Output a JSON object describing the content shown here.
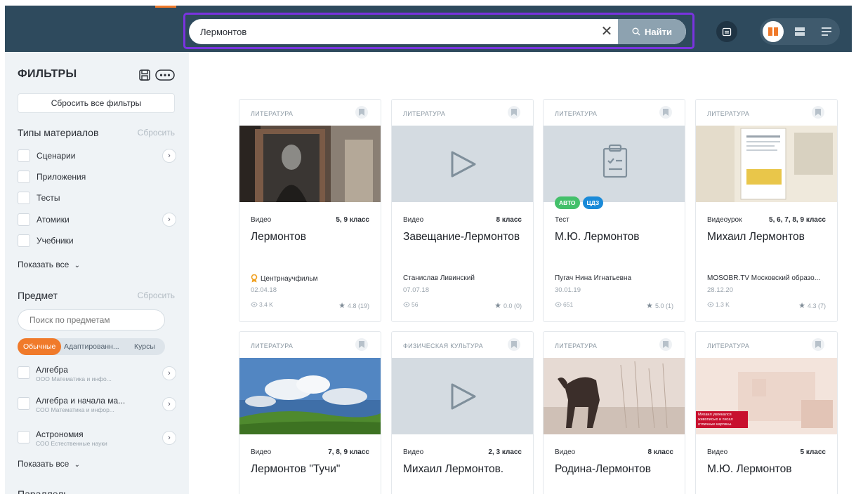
{
  "header": {
    "search_value": "Лермонтов",
    "search_button": "Найти"
  },
  "sidebar": {
    "title": "ФИЛЬТРЫ",
    "reset_all": "Сбросить все фильтры",
    "types": {
      "title": "Типы материалов",
      "reset": "Сбросить",
      "items": [
        {
          "label": "Сценарии"
        },
        {
          "label": "Приложения"
        },
        {
          "label": "Тесты"
        },
        {
          "label": "Атомики"
        },
        {
          "label": "Учебники"
        }
      ],
      "show_all": "Показать все"
    },
    "subjects": {
      "title": "Предмет",
      "reset": "Сбросить",
      "search_placeholder": "Поиск по предметам",
      "tabs": [
        "Обычные",
        "Адаптированн...",
        "Курсы"
      ],
      "items": [
        {
          "name": "Алгебра",
          "sub": "ООО Математика и инфо..."
        },
        {
          "name": "Алгебра и начала ма...",
          "sub": "СОО Математика и инфор..."
        },
        {
          "name": "Астрономия",
          "sub": "СОО Естественные науки"
        }
      ],
      "show_all": "Показать все",
      "next_title": "Параллель"
    }
  },
  "cards": [
    {
      "subject": "ЛИТЕРАТУРА",
      "type": "Видео",
      "grade": "5, 9 класс",
      "title": "Лермонтов",
      "author": "Центрнаучфильм",
      "date": "02.04.18",
      "views": "3.4 K",
      "rating": "4.8 (19)"
    },
    {
      "subject": "ЛИТЕРАТУРА",
      "type": "Видео",
      "grade": "8 класс",
      "title": "Завещание-Лермонтов",
      "author": "Станислав Ливинский",
      "date": "07.07.18",
      "views": "56",
      "rating": "0.0 (0)"
    },
    {
      "subject": "ЛИТЕРАТУРА",
      "type": "Тест",
      "grade": "",
      "title": "М.Ю. Лермонтов",
      "author": "Пугач Нина Игнатьевна",
      "date": "30.01.19",
      "views": "651",
      "rating": "5.0 (1)",
      "badges": [
        "АВТО",
        "ЦДЗ"
      ]
    },
    {
      "subject": "ЛИТЕРАТУРА",
      "type": "Видеоурок",
      "grade": "5, 6, 7, 8, 9 класс",
      "title": "Михаил Лермонтов",
      "author": "MOSOBR.TV Московский образо...",
      "date": "28.12.20",
      "views": "1.3 K",
      "rating": "4.3 (7)"
    },
    {
      "subject": "ЛИТЕРАТУРА",
      "type": "Видео",
      "grade": "7, 8, 9 класс",
      "title": "Лермонтов \"Тучи\""
    },
    {
      "subject": "ФИЗИЧЕСКАЯ КУЛЬТУРА",
      "type": "Видео",
      "grade": "2, 3 класс",
      "title": "Михаил Лермонтов."
    },
    {
      "subject": "ЛИТЕРАТУРА",
      "type": "Видео",
      "grade": "8 класс",
      "title": "Родина-Лермонтов"
    },
    {
      "subject": "ЛИТЕРАТУРА",
      "type": "Видео",
      "grade": "5 класс",
      "title": "М.Ю. Лермонтов",
      "media_caption": "Михаил увлекался живописью и писал отличные картины."
    }
  ],
  "colors": {
    "header_bg": "#2e4a5d",
    "accent_orange": "#f07a2a",
    "highlight_purple": "#7a33e0",
    "badge_green": "#43c06a",
    "badge_blue": "#1a8ad8"
  }
}
